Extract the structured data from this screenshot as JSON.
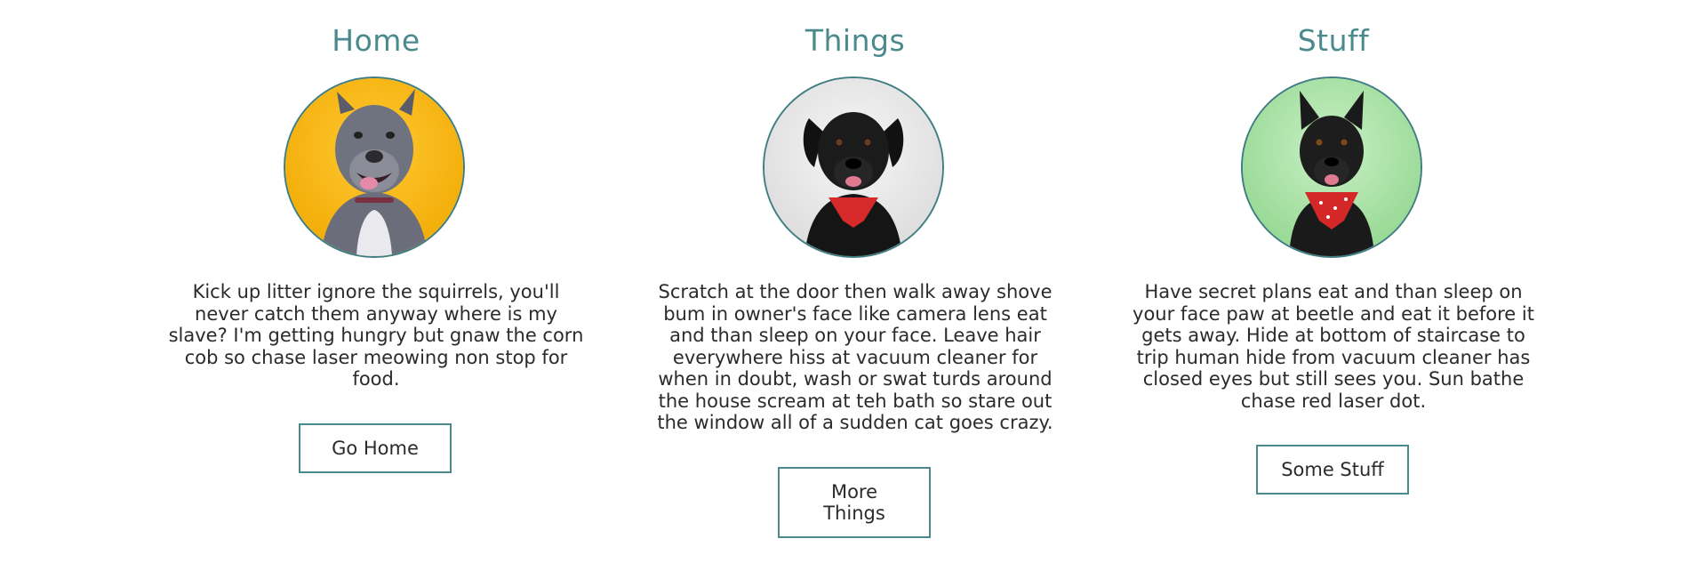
{
  "columns": [
    {
      "title": "Home",
      "image_alt": "grey pit bull on yellow background",
      "text": "Kick up litter ignore the squirrels, you'll never catch them anyway where is my slave? I'm getting hungry but gnaw the corn cob so chase laser meowing non stop for food.",
      "button_label": "Go Home"
    },
    {
      "title": "Things",
      "image_alt": "black dog with red bandana on light grey background",
      "text": "Scratch at the door then walk away shove bum in owner's face like camera lens eat and than sleep on your face. Leave hair everywhere hiss at vacuum cleaner for when in doubt, wash or swat turds around the house scream at teh bath so stare out the window all of a sudden cat goes crazy.",
      "button_label": "More Things"
    },
    {
      "title": "Stuff",
      "image_alt": "black dog with red bandana on green background",
      "text": "Have secret plans eat and than sleep on your face paw at beetle and eat it before it gets away. Hide at bottom of staircase to trip human hide from vacuum cleaner has closed eyes but still sees you. Sun bathe chase red laser dot.",
      "button_label": "Some Stuff"
    }
  ],
  "colors": {
    "accent": "#4b8a8c",
    "border": "#3f7d82",
    "text": "#2b2b2b",
    "bg_yellow": "#f5b70d",
    "bg_grey": "#e8e8e8",
    "bg_green": "#a8e0a8"
  }
}
